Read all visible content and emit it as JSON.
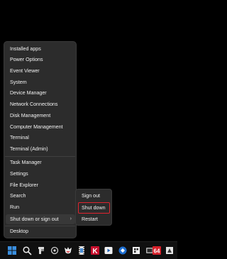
{
  "menu": {
    "items": [
      {
        "label": "Installed apps"
      },
      {
        "label": "Power Options"
      },
      {
        "label": "Event Viewer"
      },
      {
        "label": "System"
      },
      {
        "label": "Device Manager"
      },
      {
        "label": "Network Connections"
      },
      {
        "label": "Disk Management"
      },
      {
        "label": "Computer Management"
      },
      {
        "label": "Terminal"
      },
      {
        "label": "Terminal (Admin)"
      },
      {
        "label": "Task Manager"
      },
      {
        "label": "Settings"
      },
      {
        "label": "File Explorer"
      },
      {
        "label": "Search"
      },
      {
        "label": "Run"
      },
      {
        "label": "Shut down or sign out"
      },
      {
        "label": "Desktop"
      }
    ],
    "submenu_chevron": "›"
  },
  "submenu": {
    "items": [
      {
        "label": "Sign out"
      },
      {
        "label": "Shut down"
      },
      {
        "label": "Restart"
      }
    ],
    "highlight_color": "#e0242f"
  },
  "taskbar": {
    "icons": [
      {
        "name": "windows-start-icon",
        "color": "#3a8fe0"
      },
      {
        "name": "search-icon",
        "color": "#e8e8e8"
      },
      {
        "name": "app-icon"
      },
      {
        "name": "app-icon"
      },
      {
        "name": "app-icon"
      },
      {
        "name": "app-icon"
      },
      {
        "name": "app-icon",
        "text": "K",
        "color": "#c8102e"
      },
      {
        "name": "app-icon"
      },
      {
        "name": "app-icon"
      },
      {
        "name": "app-icon"
      },
      {
        "name": "app-icon"
      },
      {
        "name": "app-icon",
        "text": "64",
        "color": "#d6202a"
      },
      {
        "name": "app-icon"
      }
    ]
  }
}
